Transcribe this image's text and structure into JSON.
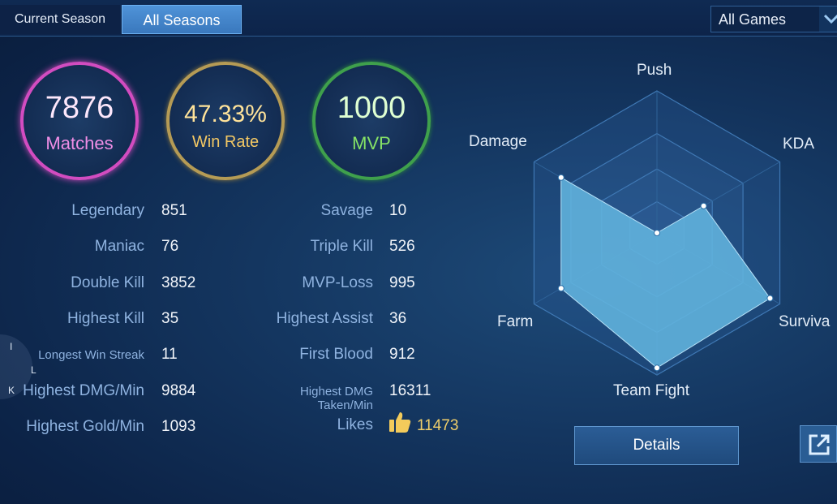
{
  "tabs": {
    "current": "Current Season",
    "all": "All Seasons"
  },
  "filter": {
    "selected": "All Games"
  },
  "summary": {
    "matches": {
      "value": "7876",
      "label": "Matches"
    },
    "win_rate": {
      "value": "47.33%",
      "label": "Win Rate"
    },
    "mvp": {
      "value": "1000",
      "label": "MVP"
    }
  },
  "stats_left": [
    {
      "label": "Legendary",
      "value": "851"
    },
    {
      "label": "Maniac",
      "value": "76"
    },
    {
      "label": "Double Kill",
      "value": "3852"
    },
    {
      "label": "Highest Kill",
      "value": "35"
    },
    {
      "label": "Longest Win Streak",
      "value": "11"
    },
    {
      "label": "Highest DMG/Min",
      "value": "9884"
    },
    {
      "label": "Highest Gold/Min",
      "value": "1093"
    }
  ],
  "stats_right": [
    {
      "label": "Savage",
      "value": "10"
    },
    {
      "label": "Triple Kill",
      "value": "526"
    },
    {
      "label": "MVP-Loss",
      "value": "995"
    },
    {
      "label": "Highest Assist",
      "value": "36"
    },
    {
      "label": "First Blood",
      "value": "912"
    },
    {
      "label": "Highest DMG Taken/Min",
      "value": "16311"
    },
    {
      "label": "Likes",
      "value": "11473"
    }
  ],
  "overlay_letters": {
    "a": "I",
    "b": "L",
    "c": "K"
  },
  "radar": {
    "axes": [
      "Push",
      "KDA",
      "Surviva",
      "Team Fight",
      "Farm",
      "Damage"
    ],
    "levels_normalized": [
      0.0,
      0.38,
      0.92,
      0.95,
      0.78,
      0.78
    ],
    "fill_color": "#62b4de"
  },
  "buttons": {
    "details": "Details"
  },
  "icons": [
    "chevron-down-icon",
    "thumbs-up-icon",
    "share-icon"
  ]
}
